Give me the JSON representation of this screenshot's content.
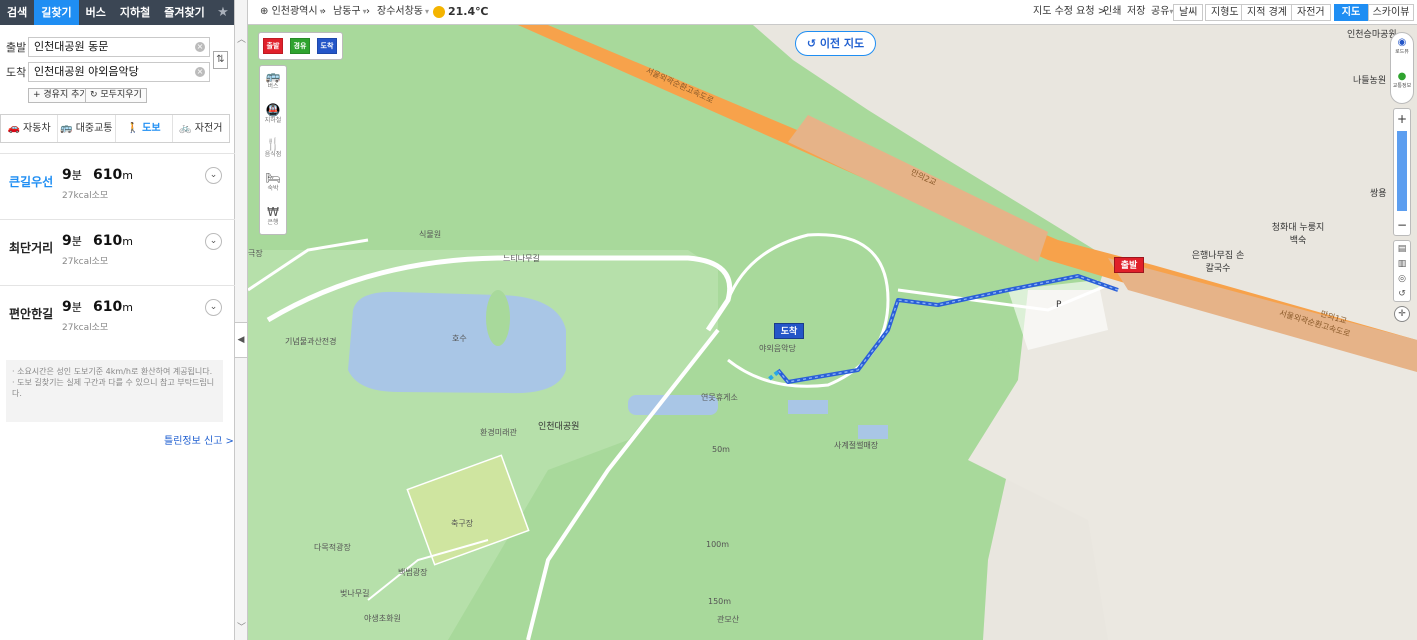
{
  "top_nav": {
    "tabs": [
      "검색",
      "길찾기",
      "버스",
      "지하철",
      "즐겨찾기"
    ],
    "active_tab": "길찾기"
  },
  "route_form": {
    "start_label": "출발",
    "start_value": "인천대공원 동문",
    "end_label": "도착",
    "end_value": "인천대공원 야외음악당",
    "add_waypoint": "+ 경유지 추가",
    "clear_all": "모두지우기"
  },
  "modes": [
    {
      "label": "자동차",
      "icon": "car-icon"
    },
    {
      "label": "대중교통",
      "icon": "bus-icon"
    },
    {
      "label": "도보",
      "icon": "walk-icon"
    },
    {
      "label": "자전거",
      "icon": "bicycle-icon"
    }
  ],
  "active_mode": "도보",
  "routes": [
    {
      "name": "큰길우선",
      "duration_num": "9",
      "duration_unit": "분",
      "distance_num": "610",
      "distance_unit": "m",
      "kcal": "27kcal소모"
    },
    {
      "name": "최단거리",
      "duration_num": "9",
      "duration_unit": "분",
      "distance_num": "610",
      "distance_unit": "m",
      "kcal": "27kcal소모"
    },
    {
      "name": "편안한길",
      "duration_num": "9",
      "duration_unit": "분",
      "distance_num": "610",
      "distance_unit": "m",
      "kcal": "27kcal소모"
    }
  ],
  "notice": [
    "· 소요시간은 성인 도보기준 4km/h로 환산하여 계공됩니다.",
    "· 도보 길찾기는 실제 구간과 다를 수 있으니 참고 부탁드립니다."
  ],
  "report_link": "틀린정보 신고 >",
  "map_header": {
    "region1": "인천광역시",
    "region2": "남동구",
    "region3": "장수서창동",
    "temperature": "21.4℃",
    "links": [
      "지도 수정 요청 >",
      "인쇄",
      "저장",
      "공유"
    ],
    "layers": [
      "날씨",
      "지형도",
      "지적 경계",
      "자전거"
    ],
    "view_active": "지도",
    "view_other": "스카이뷰"
  },
  "prev_map_button": "이전 지도",
  "flag_tools": [
    "출발",
    "경유",
    "도착"
  ],
  "poi_tools": [
    {
      "label": "버스",
      "icon": "bus-icon"
    },
    {
      "label": "지하철",
      "icon": "subway-icon"
    },
    {
      "label": "음식점",
      "icon": "restaurant-icon"
    },
    {
      "label": "숙박",
      "icon": "bed-icon"
    },
    {
      "label": "은행",
      "icon": "bank-icon"
    }
  ],
  "right_tools": [
    "로드뷰",
    "교통정보"
  ],
  "map_labels": {
    "highway": "서울외곽순환고속도로",
    "interchange": "만의2교",
    "interchange2": "만의1교",
    "park": "인천대공원",
    "lake": "호수",
    "dtree": "느티나무길",
    "garden": "식물원",
    "museum": "기념물과산전경",
    "gallery": "환경미래관",
    "rest": "연못휴게소",
    "seasons": "사계절썰매장",
    "soccer": "축구장",
    "plaza1": "다목적광장",
    "plaza2": "백범광장",
    "cherry": "벚나무길",
    "flower": "야생초화원",
    "gwanmo": "관모산",
    "theater": "극장",
    "amph": "야외음악당",
    "restA": "은행나무집 손칼국수",
    "restB": "청화대 누룽지백숙",
    "farm": "나들농원",
    "gym": "인천승마공원",
    "ssang": "쌍용",
    "m50": "50m",
    "m100": "100m",
    "m150": "150m",
    "parking": "P"
  },
  "pins": {
    "start": "출발",
    "end": "도착"
  },
  "colors": {
    "accent": "#1f8ef3",
    "nav_bg": "#3b4654",
    "route": "#2a5fd8",
    "start_pin": "#e0202a",
    "end_pin": "#2456c8",
    "park": "#a6d89a",
    "water": "#a9c6e6",
    "highway": "#f7a24b"
  }
}
